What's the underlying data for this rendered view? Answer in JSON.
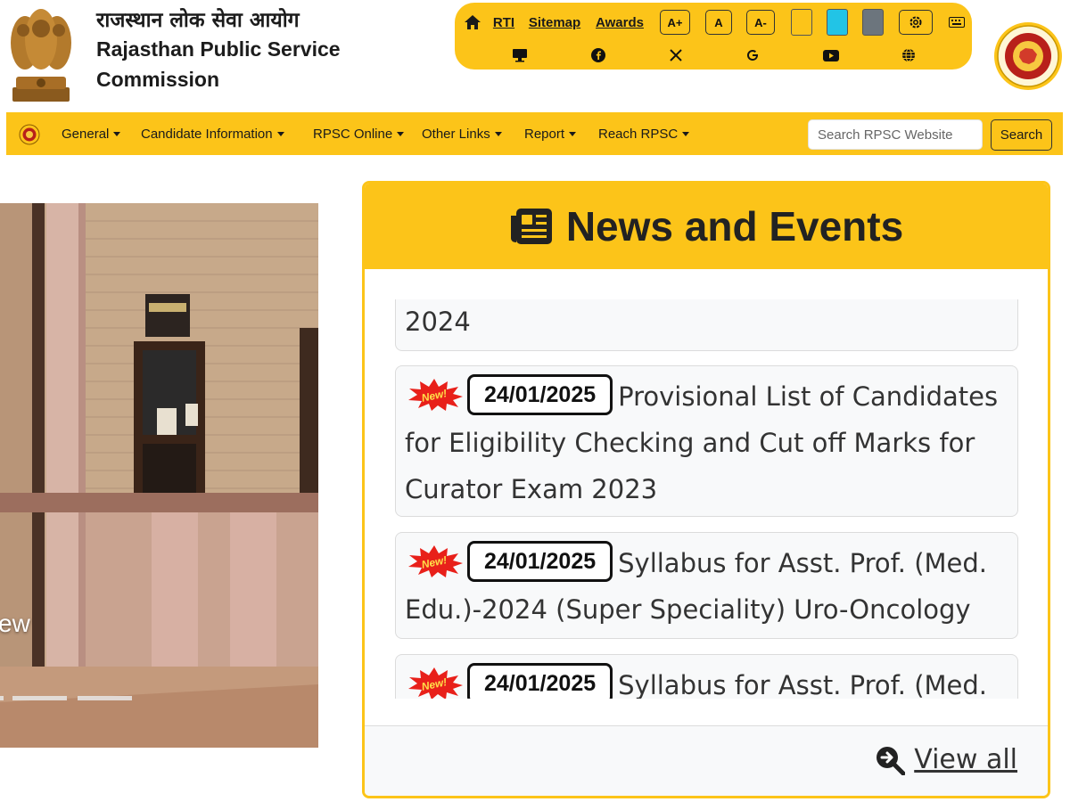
{
  "header": {
    "title_hindi": "राजस्थान लोक सेवा आयोग",
    "title_english_line1": "Rajasthan Public Service",
    "title_english_line2": "Commission"
  },
  "accessibility": {
    "links": [
      "RTI",
      "Sitemap",
      "Awards"
    ],
    "font_buttons": [
      "A+",
      "A",
      "A-"
    ],
    "swatches": [
      "#fcc419",
      "#22c4e6",
      "#6c757d"
    ],
    "icons_row1": [
      "home-icon",
      "gear-icon",
      "keyboard-icon"
    ],
    "icons_row2": [
      "desktop-icon",
      "facebook-icon",
      "x-icon",
      "google-icon",
      "youtube-icon",
      "globe-icon"
    ]
  },
  "nav": {
    "items": [
      "General",
      "Candidate Information",
      "RPSC Online",
      "Other Links",
      "Report",
      "Reach RPSC"
    ],
    "search_placeholder": "Search RPSC Website",
    "search_button": "Search"
  },
  "carousel": {
    "caption_fragment": "ew",
    "indicator_count": 3
  },
  "news": {
    "title": "News and Events",
    "partial_item_text": "2024",
    "new_badge_text": "New!",
    "items": [
      {
        "date": "24/01/2025",
        "text": "Provisional List of Candidates for Eligibility Checking and Cut off Marks for Curator Exam 2023"
      },
      {
        "date": "24/01/2025",
        "text": "Syllabus for Asst. Prof. (Med. Edu.)-2024 (Super Speciality) Uro-Oncology"
      },
      {
        "date": "24/01/2025",
        "text": "Syllabus for Asst. Prof. (Med."
      }
    ],
    "view_all": "View all"
  },
  "colors": {
    "brand_yellow": "#fcc419",
    "card_bg": "#f8f9fa",
    "text_dark": "#222222"
  }
}
